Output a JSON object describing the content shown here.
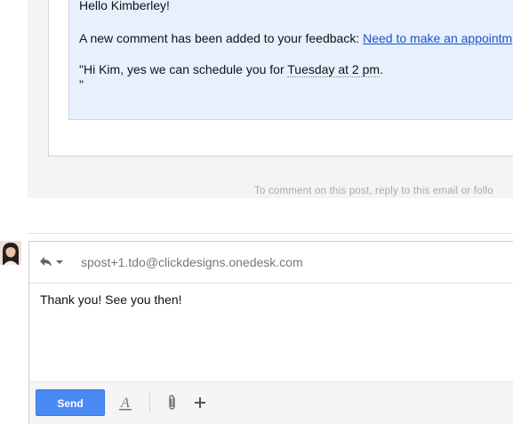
{
  "message": {
    "greeting": "Hello Kimberley!",
    "notice_prefix": "A new comment has been added to your feedback: ",
    "feedback_link": "Need to make an appointm",
    "quote_prefix": "\"Hi Kim, yes we can schedule you for ",
    "quote_date": "Tuesday at 2 pm",
    "quote_suffix": ".",
    "quote_close": "\"",
    "footer_note": "To comment on this post, reply to this email or follo"
  },
  "reply": {
    "to_address": "spost+1.tdo@clickdesigns.onedesk.com",
    "body_text": "Thank you! See you then!",
    "send_label": "Send"
  },
  "colors": {
    "send_button": "#4a8af4",
    "link": "#1a54c4",
    "quote_bg": "#e8f0fe"
  },
  "icons": {
    "reply_type": "reply-arrow-icon",
    "formatting": "text-format-icon",
    "attach": "paperclip-icon",
    "more": "plus-icon"
  }
}
